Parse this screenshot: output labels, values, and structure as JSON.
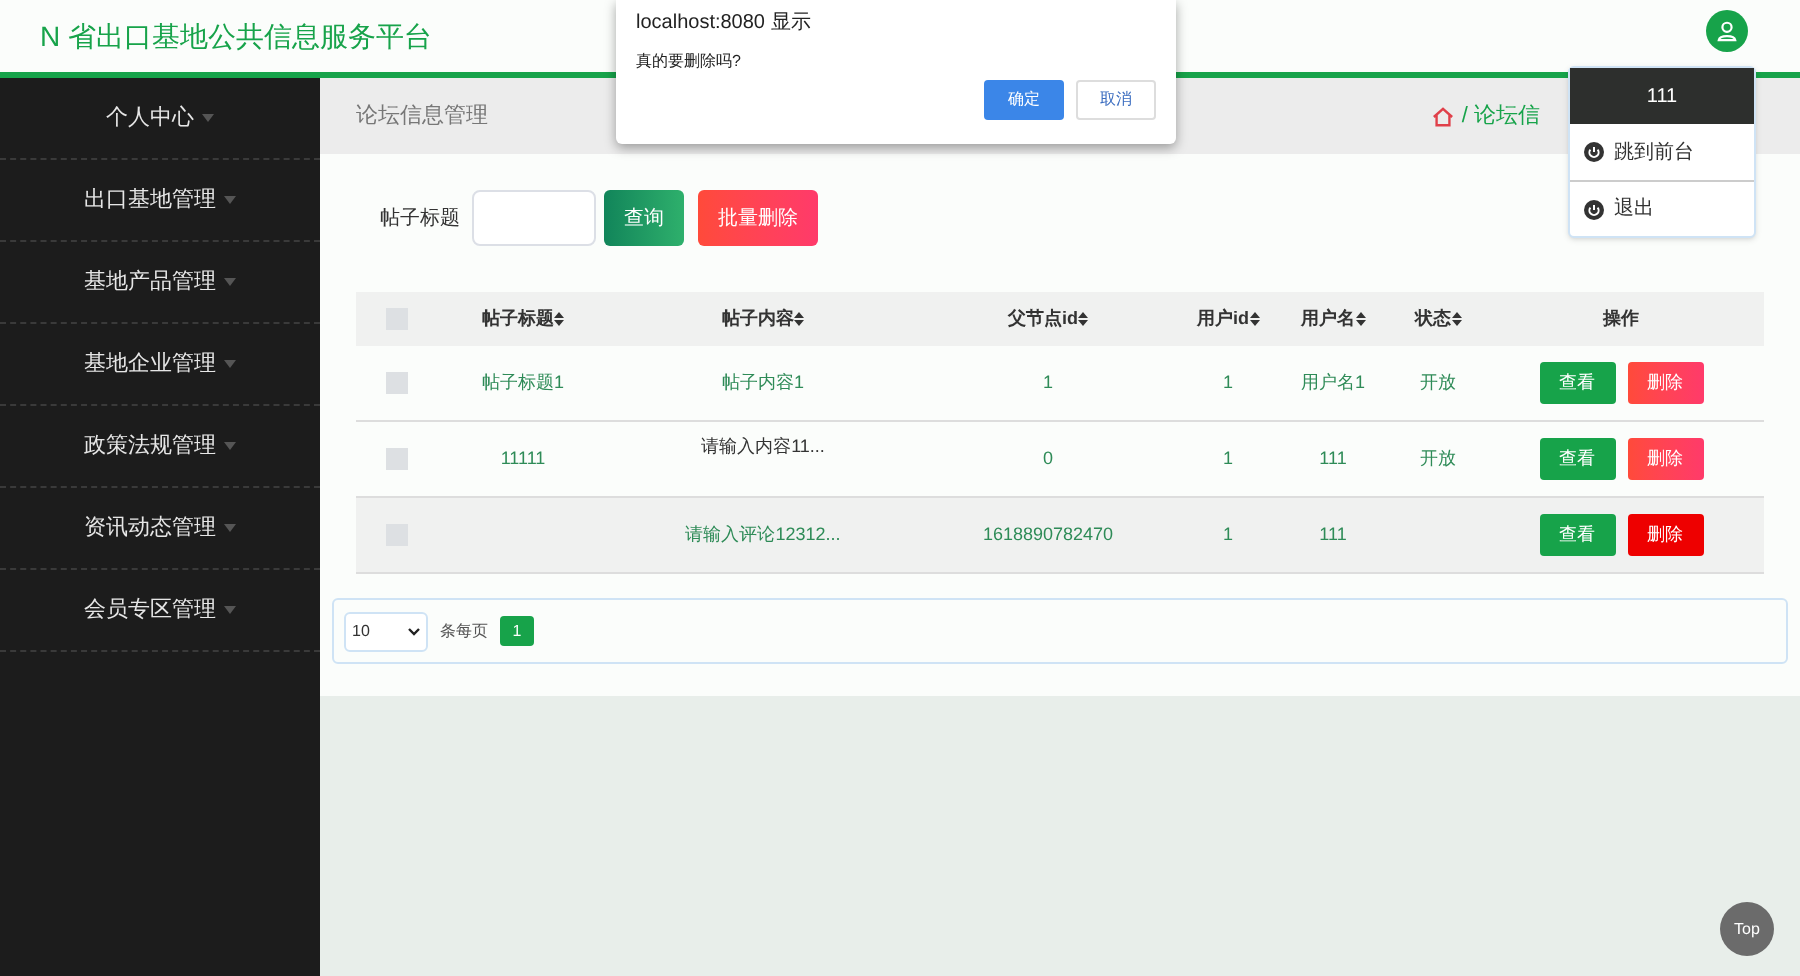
{
  "header": {
    "title": "N 省出口基地公共信息服务平台"
  },
  "sidebar": {
    "items": [
      {
        "label": "个人中心"
      },
      {
        "label": "出口基地管理"
      },
      {
        "label": "基地产品管理"
      },
      {
        "label": "基地企业管理"
      },
      {
        "label": "政策法规管理"
      },
      {
        "label": "资讯动态管理"
      },
      {
        "label": "会员专区管理"
      }
    ]
  },
  "breadcrumb": {
    "page": "论坛信息管理",
    "trail": "/ 论坛信"
  },
  "search": {
    "label": "帖子标题",
    "query_button": "查询",
    "batch_delete_button": "批量删除"
  },
  "table": {
    "select_all_checked": false,
    "columns": [
      "帖子标题",
      "帖子内容",
      "父节点id",
      "用户id",
      "用户名",
      "状态",
      "操作"
    ],
    "rows": [
      {
        "checked": false,
        "hovered": false,
        "cells": [
          "帖子标题1",
          "帖子内容1",
          "1",
          "1",
          "用户名1",
          "开放"
        ],
        "view": "查看",
        "delete": "删除"
      },
      {
        "checked": false,
        "hovered": false,
        "cells": [
          "11111",
          "请输入内容11...",
          "0",
          "1",
          "111",
          "开放"
        ],
        "view": "查看",
        "delete": "删除"
      },
      {
        "checked": false,
        "hovered": true,
        "cells": [
          "",
          "请输入评论12312...",
          "1618890782470",
          "1",
          "111",
          ""
        ],
        "view": "查看",
        "delete": "删除"
      }
    ]
  },
  "pagination": {
    "page_size": "10",
    "per_page_label": "条每页",
    "pages": [
      {
        "label": "1",
        "selected": true
      }
    ]
  },
  "dialog": {
    "title": "localhost:8080 显示",
    "message": "真的要删除吗?",
    "ok": "确定",
    "cancel": "取消"
  },
  "user_menu": {
    "username": "111",
    "items": [
      {
        "label": "跳到前台"
      },
      {
        "label": "退出"
      }
    ]
  },
  "top_button": "Top"
}
